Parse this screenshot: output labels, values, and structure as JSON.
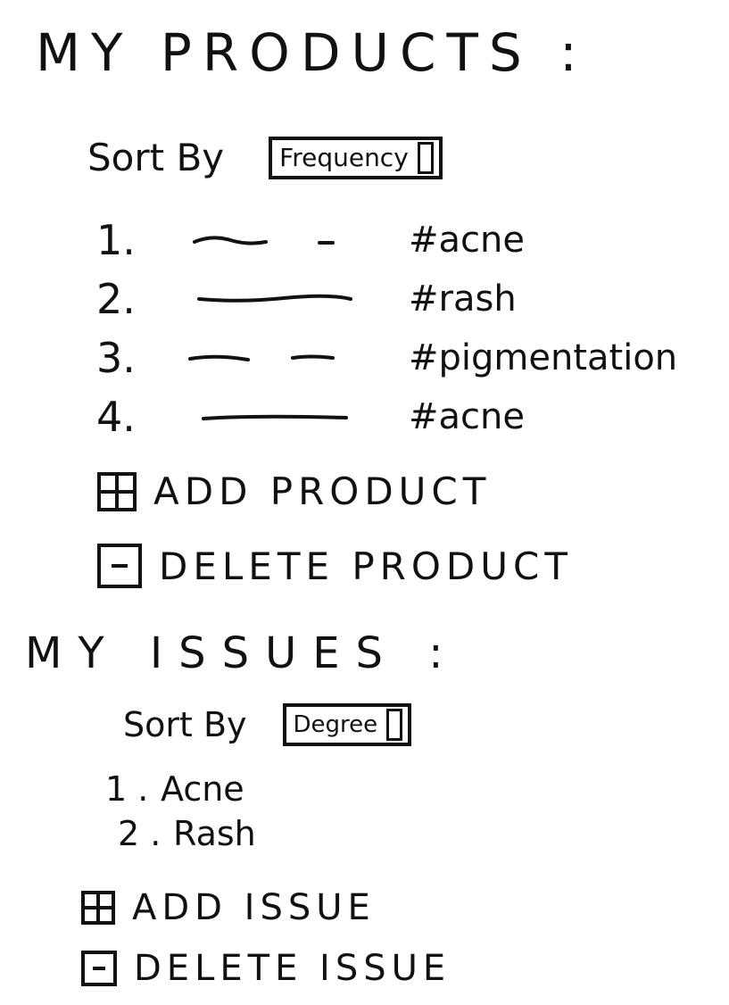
{
  "products": {
    "heading": "MY PRODUCTS :",
    "sort_label": "Sort By",
    "sort_value": "Frequency",
    "items": [
      {
        "num": "1.",
        "tag": "#acne"
      },
      {
        "num": "2.",
        "tag": "#rash"
      },
      {
        "num": "3.",
        "tag": "#pigmentation"
      },
      {
        "num": "4.",
        "tag": "#acne"
      }
    ],
    "add_label": "ADD PRODUCT",
    "delete_label": "DELETE PRODUCT"
  },
  "issues": {
    "heading": "MY ISSUES :",
    "sort_label": "Sort By",
    "sort_value": "Degree",
    "items": [
      {
        "num": "1 .",
        "name": "Acne"
      },
      {
        "num": "2 .",
        "name": "Rash"
      }
    ],
    "add_label": "ADD ISSUE",
    "delete_label": "DELETE ISSUE"
  },
  "icons": {
    "add": "plus-box-icon",
    "delete": "minus-box-icon",
    "caret": "dropdown-caret-icon"
  }
}
